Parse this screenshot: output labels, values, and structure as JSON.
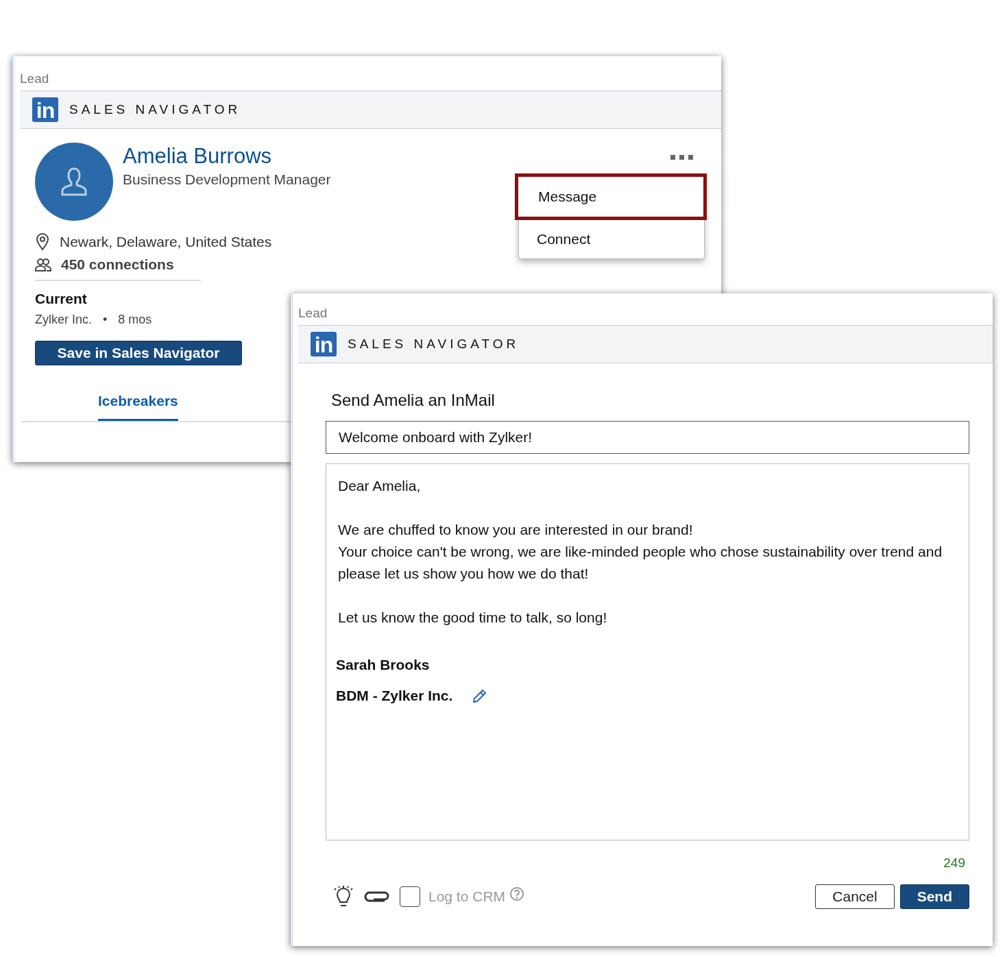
{
  "profile_window": {
    "label": "Lead",
    "header": {
      "logo": "in",
      "title": "SALES NAVIGATOR"
    },
    "name": "Amelia Burrows",
    "job_title": "Business Development Manager",
    "location": "Newark, Delaware, United States",
    "connections": "450 connections",
    "current_heading": "Current",
    "company": "Zylker Inc.",
    "separator": "•",
    "tenure": "8 mos",
    "save_button": "Save in Sales Navigator",
    "tabs": [
      {
        "label": "Icebreakers",
        "selected": true
      }
    ],
    "menu": [
      {
        "label": "Message",
        "highlighted": true
      },
      {
        "label": "Connect",
        "highlighted": false
      }
    ]
  },
  "inmail_window": {
    "label": "Lead",
    "header": {
      "logo": "in",
      "title": "SALES NAVIGATOR"
    },
    "title": "Send Amelia an InMail",
    "subject": "Welcome onboard with Zylker!",
    "body": [
      {
        "kind": "text",
        "lines": [
          "Dear Amelia,"
        ]
      },
      {
        "kind": "text",
        "lines": [
          "We are chuffed to know you are interested in our brand!",
          "Your choice can't be wrong, we are like-minded people who chose sustainability over trend and please let us show you how we do that!"
        ]
      },
      {
        "kind": "text",
        "lines": [
          "Let us know the good time to talk, so long!"
        ]
      },
      {
        "kind": "signature",
        "lines": [
          "Sarah Brooks",
          "BDM - Zylker Inc."
        ]
      }
    ],
    "char_count": "249",
    "log_to_crm": {
      "label": "Log to CRM",
      "checked": false
    },
    "buttons": [
      {
        "label": "Cancel",
        "kind": "secondary"
      },
      {
        "label": "Send",
        "kind": "primary"
      }
    ]
  }
}
